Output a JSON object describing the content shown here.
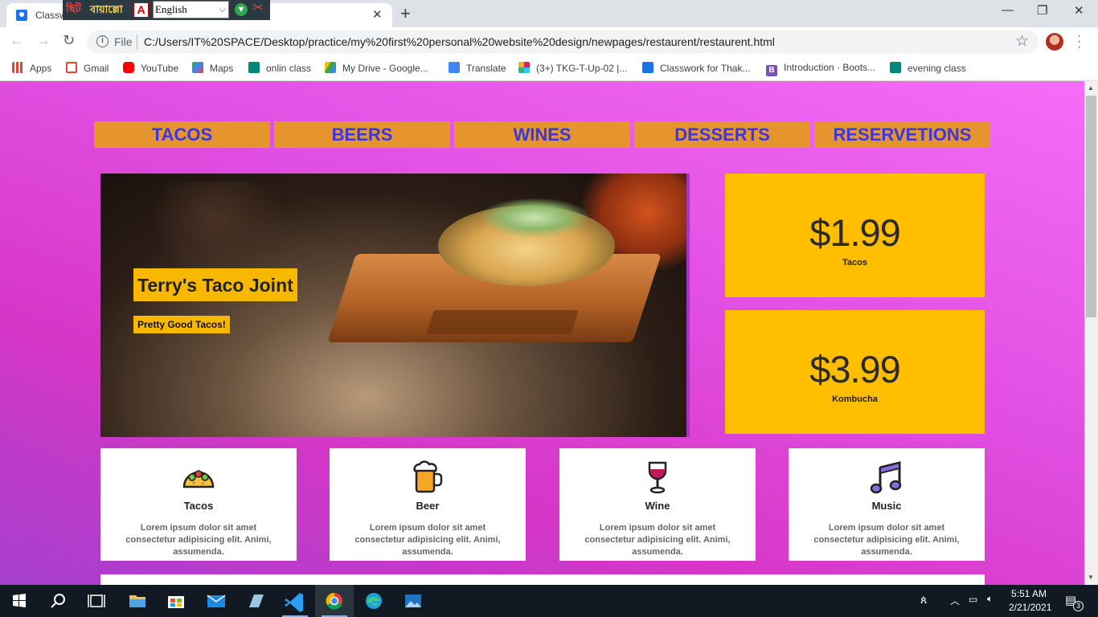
{
  "browser": {
    "tab": {
      "title": "Classw",
      "favicon": "classroom-icon"
    },
    "window_controls": {
      "minimize": "—",
      "restore": "❐",
      "close": "✕"
    },
    "omnibox": {
      "scheme_label": "File",
      "url": "C:/Users/IT%20SPACE/Desktop/practice/my%20first%20personal%20website%20design/newpages/restaurent/restaurent.html"
    },
    "bookmarks": [
      {
        "label": "Apps",
        "icon": "apps-grid-icon",
        "color": "#ea4335"
      },
      {
        "label": "Gmail",
        "icon": "gmail-icon",
        "color": "#ea4335"
      },
      {
        "label": "YouTube",
        "icon": "youtube-icon",
        "color": "#ff0000"
      },
      {
        "label": "Maps",
        "icon": "maps-icon",
        "color": "#34a853"
      },
      {
        "label": "onlin class",
        "icon": "meet-icon",
        "color": "#00897b"
      },
      {
        "label": "My Drive - Google...",
        "icon": "drive-icon",
        "color": "#fbbc04"
      },
      {
        "label": "Translate",
        "icon": "translate-icon",
        "color": "#4285f4"
      },
      {
        "label": "(3+) TKG-T-Up-02 |...",
        "icon": "slack-icon",
        "color": "#e01e5a"
      },
      {
        "label": "Classwork for Thak...",
        "icon": "classroom-icon",
        "color": "#1a73e8"
      },
      {
        "label": "Introduction · Boots...",
        "icon": "bootstrap-icon",
        "color": "#7952b3"
      },
      {
        "label": "evening class",
        "icon": "meet-icon",
        "color": "#00897b"
      }
    ]
  },
  "langbar": {
    "logo": "ছিট",
    "brand": "বায়াল্লো",
    "select_value": "English"
  },
  "site": {
    "menu": [
      "TACOS",
      "BEERS",
      "WINES",
      "DESSERTS",
      "RESERVETIONS"
    ],
    "hero": {
      "title": "Terry's Taco Joint",
      "subtitle": "Pretty Good Tacos!"
    },
    "prices": [
      {
        "value": "$1.99",
        "label": "Tacos"
      },
      {
        "value": "$3.99",
        "label": "Kombucha"
      }
    ],
    "cards": [
      {
        "title": "Tacos",
        "icon": "taco-icon",
        "text": "Lorem ipsum dolor sit amet consectetur adipisicing elit. Animi, assumenda."
      },
      {
        "title": "Beer",
        "icon": "beer-mug-icon",
        "text": "Lorem ipsum dolor sit amet consectetur adipisicing elit. Animi, assumenda."
      },
      {
        "title": "Wine",
        "icon": "wine-glass-icon",
        "text": "Lorem ipsum dolor sit amet consectetur adipisicing elit. Animi, assumenda."
      },
      {
        "title": "Music",
        "icon": "music-notes-icon",
        "text": "Lorem ipsum dolor sit amet consectetur adipisicing elit. Animi, assumenda."
      }
    ],
    "colors": {
      "menu_bg": "#e6952e",
      "menu_text": "#3b36e0",
      "price_bg": "#ffbf00",
      "hero_label_bg": "#f8b800"
    }
  },
  "taskbar": {
    "time": "5:51 AM",
    "date": "2/21/2021",
    "notification_count": "3",
    "apps": [
      "start-icon",
      "search-icon",
      "task-view-icon",
      "file-explorer-icon",
      "store-icon",
      "mail-icon",
      "app-icon",
      "vscode-icon",
      "chrome-icon",
      "edge-icon",
      "photos-icon"
    ]
  }
}
